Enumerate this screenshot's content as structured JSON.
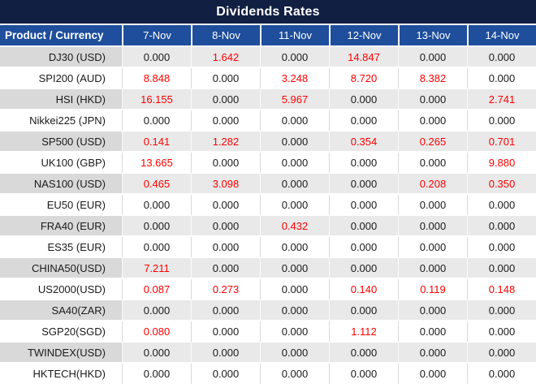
{
  "title": "Dividends Rates",
  "colors": {
    "title_bg": "#101f42",
    "header_bg": "#1e4e9c",
    "header_text": "#ffffff",
    "gray_row_product_bg": "#d9d9d9",
    "gray_row_value_bg": "#e9e9e9",
    "white_row_bg": "#ffffff",
    "zero_value_text": "#1a1a1a",
    "nonzero_value_text": "#fe0000"
  },
  "chart_data": {
    "type": "table",
    "title": "Dividends Rates",
    "columns": [
      "Product / Currency",
      "7-Nov",
      "8-Nov",
      "11-Nov",
      "12-Nov",
      "13-Nov",
      "14-Nov"
    ],
    "highlight_rule": "non-zero dividend values are rendered in red, zero values in black",
    "rows": [
      {
        "product": "DJ30 (USD)",
        "values": [
          "0.000",
          "1.642",
          "0.000",
          "14.847",
          "0.000",
          "0.000"
        ]
      },
      {
        "product": "SPI200 (AUD)",
        "values": [
          "8.848",
          "0.000",
          "3.248",
          "8.720",
          "8.382",
          "0.000"
        ]
      },
      {
        "product": "HSI (HKD)",
        "values": [
          "16.155",
          "0.000",
          "5.967",
          "0.000",
          "0.000",
          "2.741"
        ]
      },
      {
        "product": "Nikkei225 (JPN)",
        "values": [
          "0.000",
          "0.000",
          "0.000",
          "0.000",
          "0.000",
          "0.000"
        ]
      },
      {
        "product": "SP500 (USD)",
        "values": [
          "0.141",
          "1.282",
          "0.000",
          "0.354",
          "0.265",
          "0.701"
        ]
      },
      {
        "product": "UK100 (GBP)",
        "values": [
          "13.665",
          "0.000",
          "0.000",
          "0.000",
          "0.000",
          "9.880"
        ]
      },
      {
        "product": "NAS100 (USD)",
        "values": [
          "0.465",
          "3.098",
          "0.000",
          "0.000",
          "0.208",
          "0.350"
        ]
      },
      {
        "product": "EU50 (EUR)",
        "values": [
          "0.000",
          "0.000",
          "0.000",
          "0.000",
          "0.000",
          "0.000"
        ]
      },
      {
        "product": "FRA40 (EUR)",
        "values": [
          "0.000",
          "0.000",
          "0.432",
          "0.000",
          "0.000",
          "0.000"
        ]
      },
      {
        "product": "ES35 (EUR)",
        "values": [
          "0.000",
          "0.000",
          "0.000",
          "0.000",
          "0.000",
          "0.000"
        ]
      },
      {
        "product": "CHINA50(USD)",
        "values": [
          "7.211",
          "0.000",
          "0.000",
          "0.000",
          "0.000",
          "0.000"
        ]
      },
      {
        "product": "US2000(USD)",
        "values": [
          "0.087",
          "0.273",
          "0.000",
          "0.140",
          "0.119",
          "0.148"
        ]
      },
      {
        "product": "SA40(ZAR)",
        "values": [
          "0.000",
          "0.000",
          "0.000",
          "0.000",
          "0.000",
          "0.000"
        ]
      },
      {
        "product": "SGP20(SGD)",
        "values": [
          "0.080",
          "0.000",
          "0.000",
          "1.112",
          "0.000",
          "0.000"
        ]
      },
      {
        "product": "TWINDEX(USD)",
        "values": [
          "0.000",
          "0.000",
          "0.000",
          "0.000",
          "0.000",
          "0.000"
        ]
      },
      {
        "product": "HKTECH(HKD)",
        "values": [
          "0.000",
          "0.000",
          "0.000",
          "0.000",
          "0.000",
          "0.000"
        ]
      }
    ]
  }
}
